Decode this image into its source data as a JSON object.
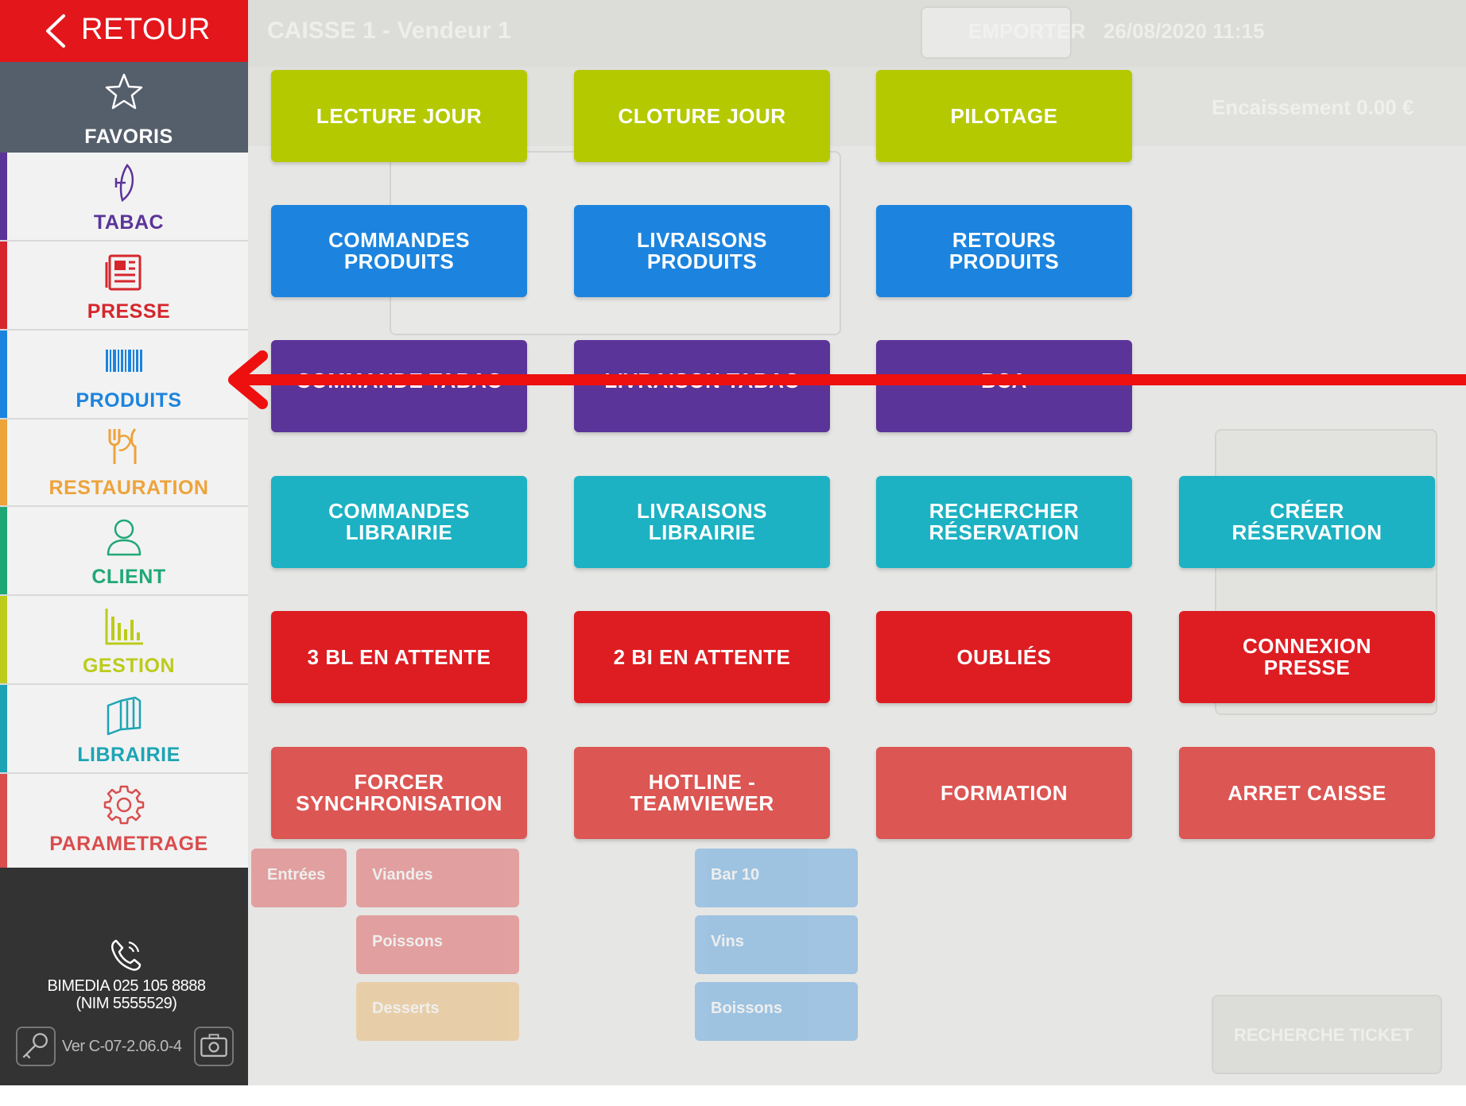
{
  "colors": {
    "red": "#e3161b",
    "favoris_bg": "#555f6b",
    "lime": "#b5c900",
    "blue": "#1c84de",
    "purple": "#5b3499",
    "teal": "#1cb2c3",
    "darkred": "#dd1d22",
    "salmon": "#dc5653",
    "arrow": "#ee0f0f"
  },
  "sidebar": {
    "back_label": "RETOUR",
    "items": [
      {
        "label": "FAVORIS",
        "icon": "star-icon",
        "color": "#ffffff",
        "bar": "#555f6b"
      },
      {
        "label": "TABAC",
        "icon": "tobacco-leaf-icon",
        "color": "#5b3499",
        "bar": "#5b3499"
      },
      {
        "label": "PRESSE",
        "icon": "newspaper-icon",
        "color": "#d6262c",
        "bar": "#d6262c"
      },
      {
        "label": "PRODUITS",
        "icon": "barcode-icon",
        "color": "#1c84de",
        "bar": "#1c84de"
      },
      {
        "label": "RESTAURATION",
        "icon": "cutlery-icon",
        "color": "#eda33a",
        "bar": "#eda33a"
      },
      {
        "label": "CLIENT",
        "icon": "user-icon",
        "color": "#1fa876",
        "bar": "#1fa876"
      },
      {
        "label": "GESTION",
        "icon": "bar-chart-icon",
        "color": "#bccb1c",
        "bar": "#bccb1c"
      },
      {
        "label": "LIBRAIRIE",
        "icon": "books-icon",
        "color": "#1ca4b5",
        "bar": "#1ca4b5"
      },
      {
        "label": "PARAMETRAGE",
        "icon": "gear-icon",
        "color": "#d94d4d",
        "bar": "#d94d4d"
      }
    ],
    "support_line1": "BIMEDIA 025 105 8888",
    "support_line2": "(NIM 5555529)",
    "version": "Ver C-07-2.06.0-4"
  },
  "tiles": [
    {
      "label": "LECTURE JOUR",
      "color": "lime"
    },
    {
      "label": "CLOTURE JOUR",
      "color": "lime"
    },
    {
      "label": "PILOTAGE",
      "color": "lime"
    },
    {
      "label": "COMMANDES\nPRODUITS",
      "color": "blue"
    },
    {
      "label": "LIVRAISONS\nPRODUITS",
      "color": "blue"
    },
    {
      "label": "RETOURS\nPRODUITS",
      "color": "blue"
    },
    {
      "label": "COMMANDE TABAC",
      "color": "purple"
    },
    {
      "label": "LIVRAISON TABAC",
      "color": "purple"
    },
    {
      "label": "BCA",
      "color": "purple"
    },
    {
      "label": "COMMANDES\nLIBRAIRIE",
      "color": "teal"
    },
    {
      "label": "LIVRAISONS\nLIBRAIRIE",
      "color": "teal"
    },
    {
      "label": "RECHERCHER\nRÉSERVATION",
      "color": "teal"
    },
    {
      "label": "CRÉER\nRÉSERVATION",
      "color": "teal"
    },
    {
      "label": "3 BL EN ATTENTE",
      "color": "darkred"
    },
    {
      "label": "2 BI EN ATTENTE",
      "color": "darkred"
    },
    {
      "label": "OUBLIÉS",
      "color": "darkred"
    },
    {
      "label": "CONNEXION\nPRESSE",
      "color": "darkred"
    },
    {
      "label": "FORCER\nSYNCHRONISATION",
      "color": "salmon"
    },
    {
      "label": "HOTLINE -\nTEAMVIEWER",
      "color": "salmon"
    },
    {
      "label": "FORMATION",
      "color": "salmon"
    },
    {
      "label": "ARRET CAISSE",
      "color": "salmon"
    }
  ],
  "background": {
    "header_title": "CAISSE 1 - Vendeur 1",
    "header_tab": "EMPORTER",
    "header_date": "26/08/2020 11:15",
    "subheader": "Encaissement 0.00 €",
    "tile_labels": [
      "Entrées",
      "Viandes",
      "Poissons",
      "Desserts",
      "Bar 10",
      "Vins",
      "Boissons"
    ],
    "search_button": "RECHERCHE TICKET"
  }
}
